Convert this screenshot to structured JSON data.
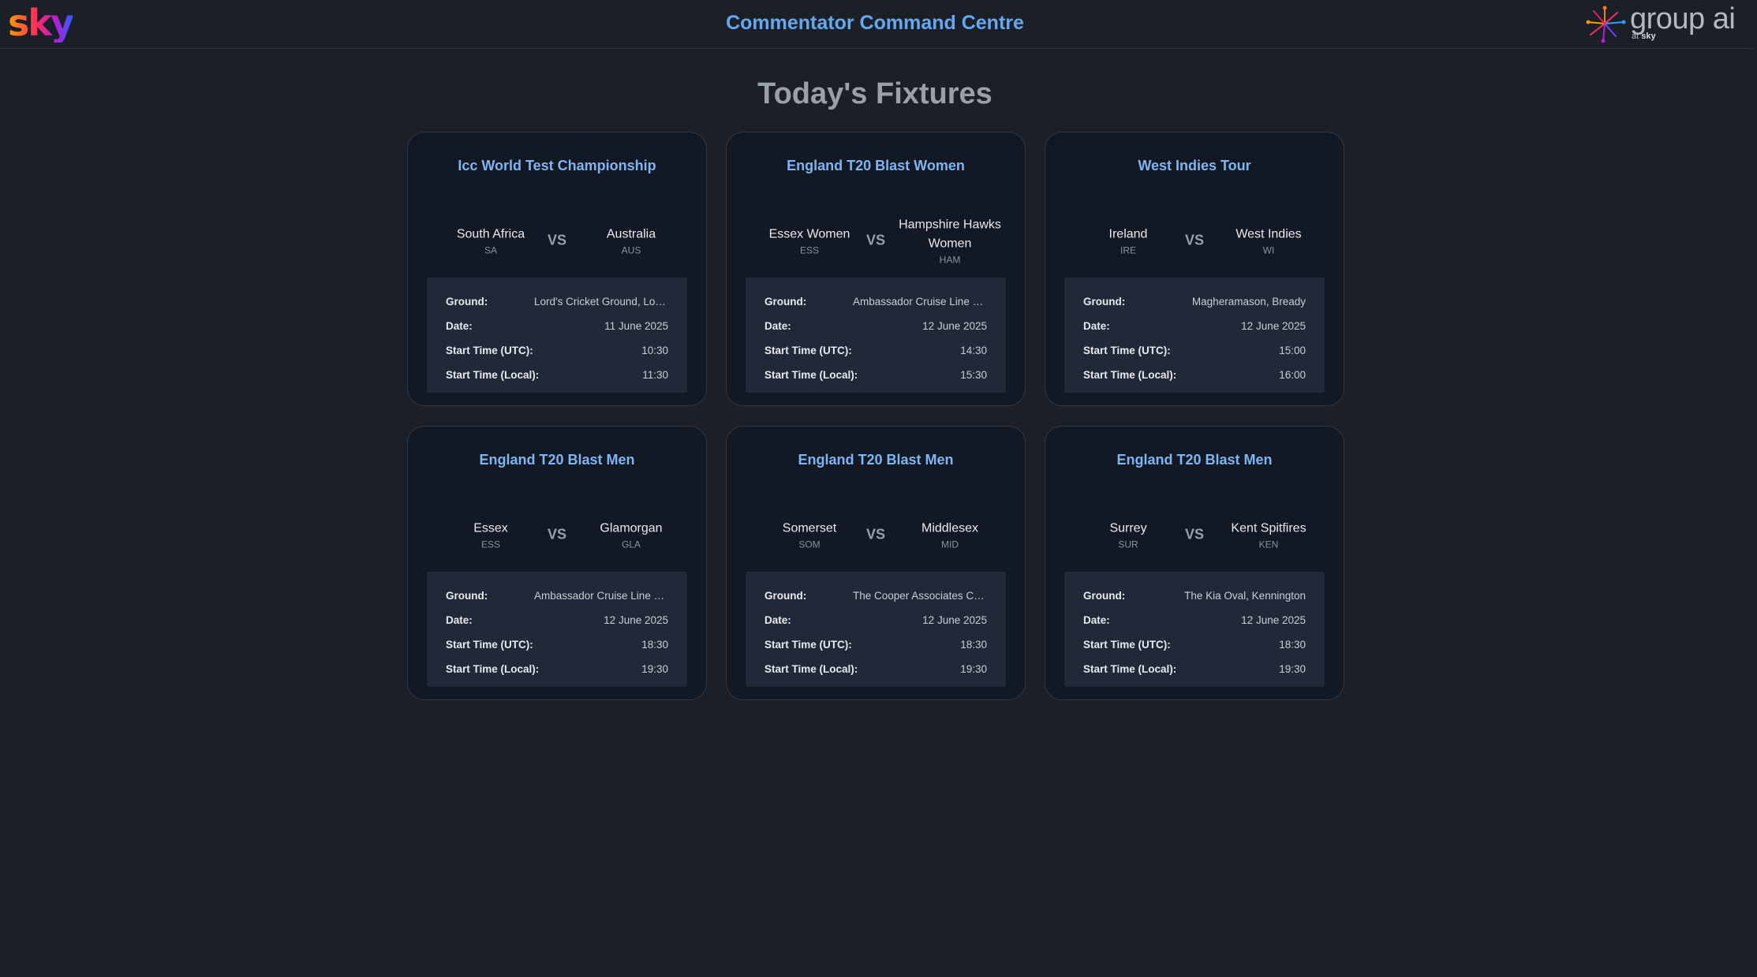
{
  "header": {
    "brand_logo": "sky",
    "title": "Commentator Command Centre",
    "partner_logo_text": "group ai",
    "partner_logo_sub": "at",
    "partner_logo_sub_brand": "sky"
  },
  "main": {
    "heading": "Today's Fixtures",
    "labels": {
      "ground": "Ground:",
      "date": "Date:",
      "start_utc": "Start Time (UTC):",
      "start_local": "Start Time (Local):",
      "vs": "VS"
    },
    "fixtures": [
      {
        "competition": "Icc World Test Championship",
        "home": {
          "name": "South Africa",
          "abbr": "SA"
        },
        "away": {
          "name": "Australia",
          "abbr": "AUS"
        },
        "ground": "Lord's Cricket Ground, London",
        "date": "11 June 2025",
        "start_utc": "10:30",
        "start_local": "11:30"
      },
      {
        "competition": "England T20 Blast Women",
        "home": {
          "name": "Essex Women",
          "abbr": "ESS"
        },
        "away": {
          "name": "Hampshire Hawks Women",
          "abbr": "HAM"
        },
        "ground": "Ambassador Cruise Line Ground",
        "date": "12 June 2025",
        "start_utc": "14:30",
        "start_local": "15:30"
      },
      {
        "competition": "West Indies Tour",
        "home": {
          "name": "Ireland",
          "abbr": "IRE"
        },
        "away": {
          "name": "West Indies",
          "abbr": "WI"
        },
        "ground": "Magheramason, Bready",
        "date": "12 June 2025",
        "start_utc": "15:00",
        "start_local": "16:00"
      },
      {
        "competition": "England T20 Blast Men",
        "home": {
          "name": "Essex",
          "abbr": "ESS"
        },
        "away": {
          "name": "Glamorgan",
          "abbr": "GLA"
        },
        "ground": "Ambassador Cruise Line Ground",
        "date": "12 June 2025",
        "start_utc": "18:30",
        "start_local": "19:30"
      },
      {
        "competition": "England T20 Blast Men",
        "home": {
          "name": "Somerset",
          "abbr": "SOM"
        },
        "away": {
          "name": "Middlesex",
          "abbr": "MID"
        },
        "ground": "The Cooper Associates County Ground",
        "date": "12 June 2025",
        "start_utc": "18:30",
        "start_local": "19:30"
      },
      {
        "competition": "England T20 Blast Men",
        "home": {
          "name": "Surrey",
          "abbr": "SUR"
        },
        "away": {
          "name": "Kent Spitfires",
          "abbr": "KEN"
        },
        "ground": "The Kia Oval, Kennington",
        "date": "12 June 2025",
        "start_utc": "18:30",
        "start_local": "19:30"
      }
    ]
  }
}
